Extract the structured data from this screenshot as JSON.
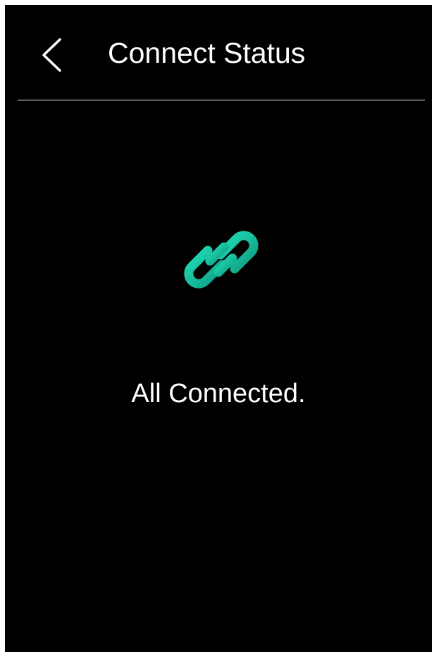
{
  "header": {
    "title": "Connect Status",
    "back_icon": "chevron-left-icon"
  },
  "status": {
    "icon": "link-icon",
    "message": "All Connected.",
    "accent_color_start": "#1dd3b0",
    "accent_color_end": "#0f9e82"
  },
  "theme": {
    "background": "#000000",
    "text": "#ffffff",
    "divider": "#5a5a5a"
  }
}
